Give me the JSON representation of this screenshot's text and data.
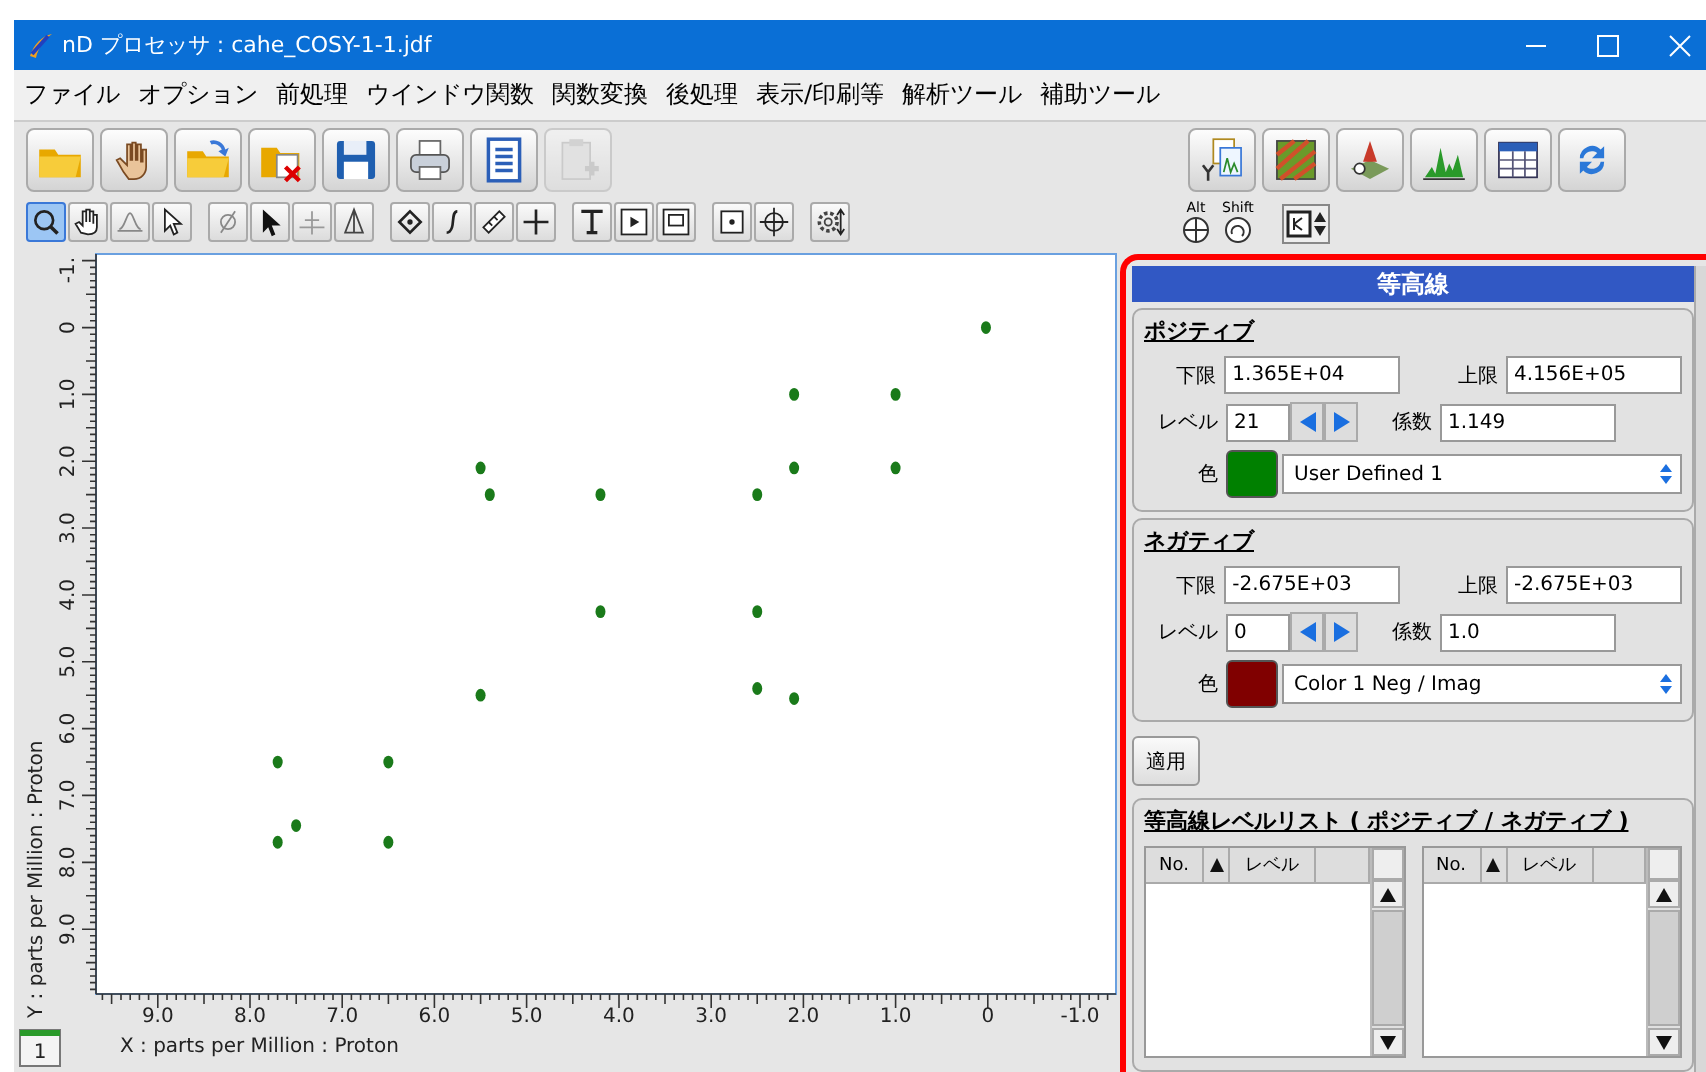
{
  "window": {
    "title": "nD プロセッサ : cahe_COSY-1-1.jdf"
  },
  "menu": [
    "ファイル",
    "オプション",
    "前処理",
    "ウインドウ関数",
    "関数変換",
    "後処理",
    "表示/印刷等",
    "解析ツール",
    "補助ツール"
  ],
  "toolbar": {
    "buttons": [
      {
        "disabled": false
      },
      {
        "disabled": false
      },
      {
        "disabled": false
      },
      {
        "disabled": false
      },
      {
        "disabled": false
      },
      {
        "disabled": false
      },
      {
        "disabled": false
      },
      {
        "disabled": true
      },
      {
        "disabled": false
      },
      {
        "disabled": false
      },
      {
        "disabled": false
      },
      {
        "disabled": false
      },
      {
        "disabled": false
      },
      {
        "disabled": false
      }
    ]
  },
  "tools": {
    "groups": [
      [
        {
          "selected": true
        },
        {
          "selected": false
        },
        {
          "selected": false
        },
        {
          "selected": false
        }
      ],
      [
        {
          "selected": false
        },
        {
          "selected": false
        },
        {
          "selected": false
        },
        {
          "selected": false
        }
      ],
      [
        {
          "selected": false
        },
        {
          "selected": false
        },
        {
          "selected": false
        },
        {
          "selected": false
        }
      ],
      [
        {
          "selected": false
        },
        {
          "selected": false
        },
        {
          "selected": false
        }
      ],
      [
        {
          "selected": false
        },
        {
          "selected": false
        }
      ],
      [
        {
          "selected": false
        }
      ]
    ],
    "modifiers": [
      "Alt",
      "Shift"
    ]
  },
  "plot": {
    "chart_data": {
      "type": "scatter",
      "xlabel": "X : parts per Million : Proton",
      "ylabel": "Y : parts per Million : Proton",
      "xlim": [
        9.67,
        -1.39
      ],
      "ylim": [
        9.97,
        -1.1
      ],
      "xticks": [
        {
          "value": 9,
          "label": "9.0"
        },
        {
          "value": 8,
          "label": "8.0"
        },
        {
          "value": 7,
          "label": "7.0"
        },
        {
          "value": 6,
          "label": "6.0"
        },
        {
          "value": 5,
          "label": "5.0"
        },
        {
          "value": 4,
          "label": "4.0"
        },
        {
          "value": 3,
          "label": "3.0"
        },
        {
          "value": 2,
          "label": "2.0"
        },
        {
          "value": 1,
          "label": "1.0"
        },
        {
          "value": 0,
          "label": "0"
        },
        {
          "value": -1,
          "label": "-1.0"
        }
      ],
      "yticks": [
        {
          "value": -1,
          "label": "-1."
        },
        {
          "value": 0,
          "label": "0"
        },
        {
          "value": 1,
          "label": "1.0"
        },
        {
          "value": 2,
          "label": "2.0"
        },
        {
          "value": 3,
          "label": "3.0"
        },
        {
          "value": 4,
          "label": "4.0"
        },
        {
          "value": 5,
          "label": "5.0"
        },
        {
          "value": 6,
          "label": "6.0"
        },
        {
          "value": 7,
          "label": "7.0"
        },
        {
          "value": 8,
          "label": "8.0"
        },
        {
          "value": 9,
          "label": "9.0"
        }
      ],
      "x": [
        0.02,
        2.1,
        1.0,
        5.5,
        5.4,
        4.2,
        2.5,
        2.1,
        1.0,
        4.2,
        2.5,
        5.5,
        2.5,
        2.1,
        7.7,
        6.5,
        7.5,
        7.7,
        6.5
      ],
      "series": [
        {
          "color": "#1a7a1a",
          "values": [
            0,
            1.0,
            1.0,
            2.1,
            2.5,
            2.5,
            2.5,
            2.1,
            2.1,
            4.25,
            4.25,
            5.5,
            5.4,
            5.55,
            6.5,
            6.5,
            7.45,
            7.7,
            7.7
          ]
        }
      ]
    },
    "page_tab": "1"
  },
  "panel": {
    "title": "等高線",
    "groups": [
      {
        "title": "ポジティブ",
        "lower_label": "下限",
        "lower": "1.365E+04",
        "upper_label": "上限",
        "upper": "4.156E+05",
        "level_label": "レベル",
        "level": "21",
        "factor_label": "係数",
        "factor": "1.149",
        "color_label": "色",
        "color": "#008000",
        "color_name": "User Defined 1"
      },
      {
        "title": "ネガティブ",
        "lower_label": "下限",
        "lower": "-2.675E+03",
        "upper_label": "上限",
        "upper": "-2.675E+03",
        "level_label": "レベル",
        "level": "0",
        "factor_label": "係数",
        "factor": "1.0",
        "color_label": "色",
        "color": "#800000",
        "color_name": "Color 1 Neg / Imag"
      }
    ],
    "apply": "適用",
    "level_list": {
      "title": "等高線レベルリスト ( ポジティブ / ネガティブ )",
      "tables": [
        {
          "columns": [
            "No.",
            "レベル"
          ]
        },
        {
          "columns": [
            "No.",
            "レベル"
          ]
        }
      ]
    }
  }
}
